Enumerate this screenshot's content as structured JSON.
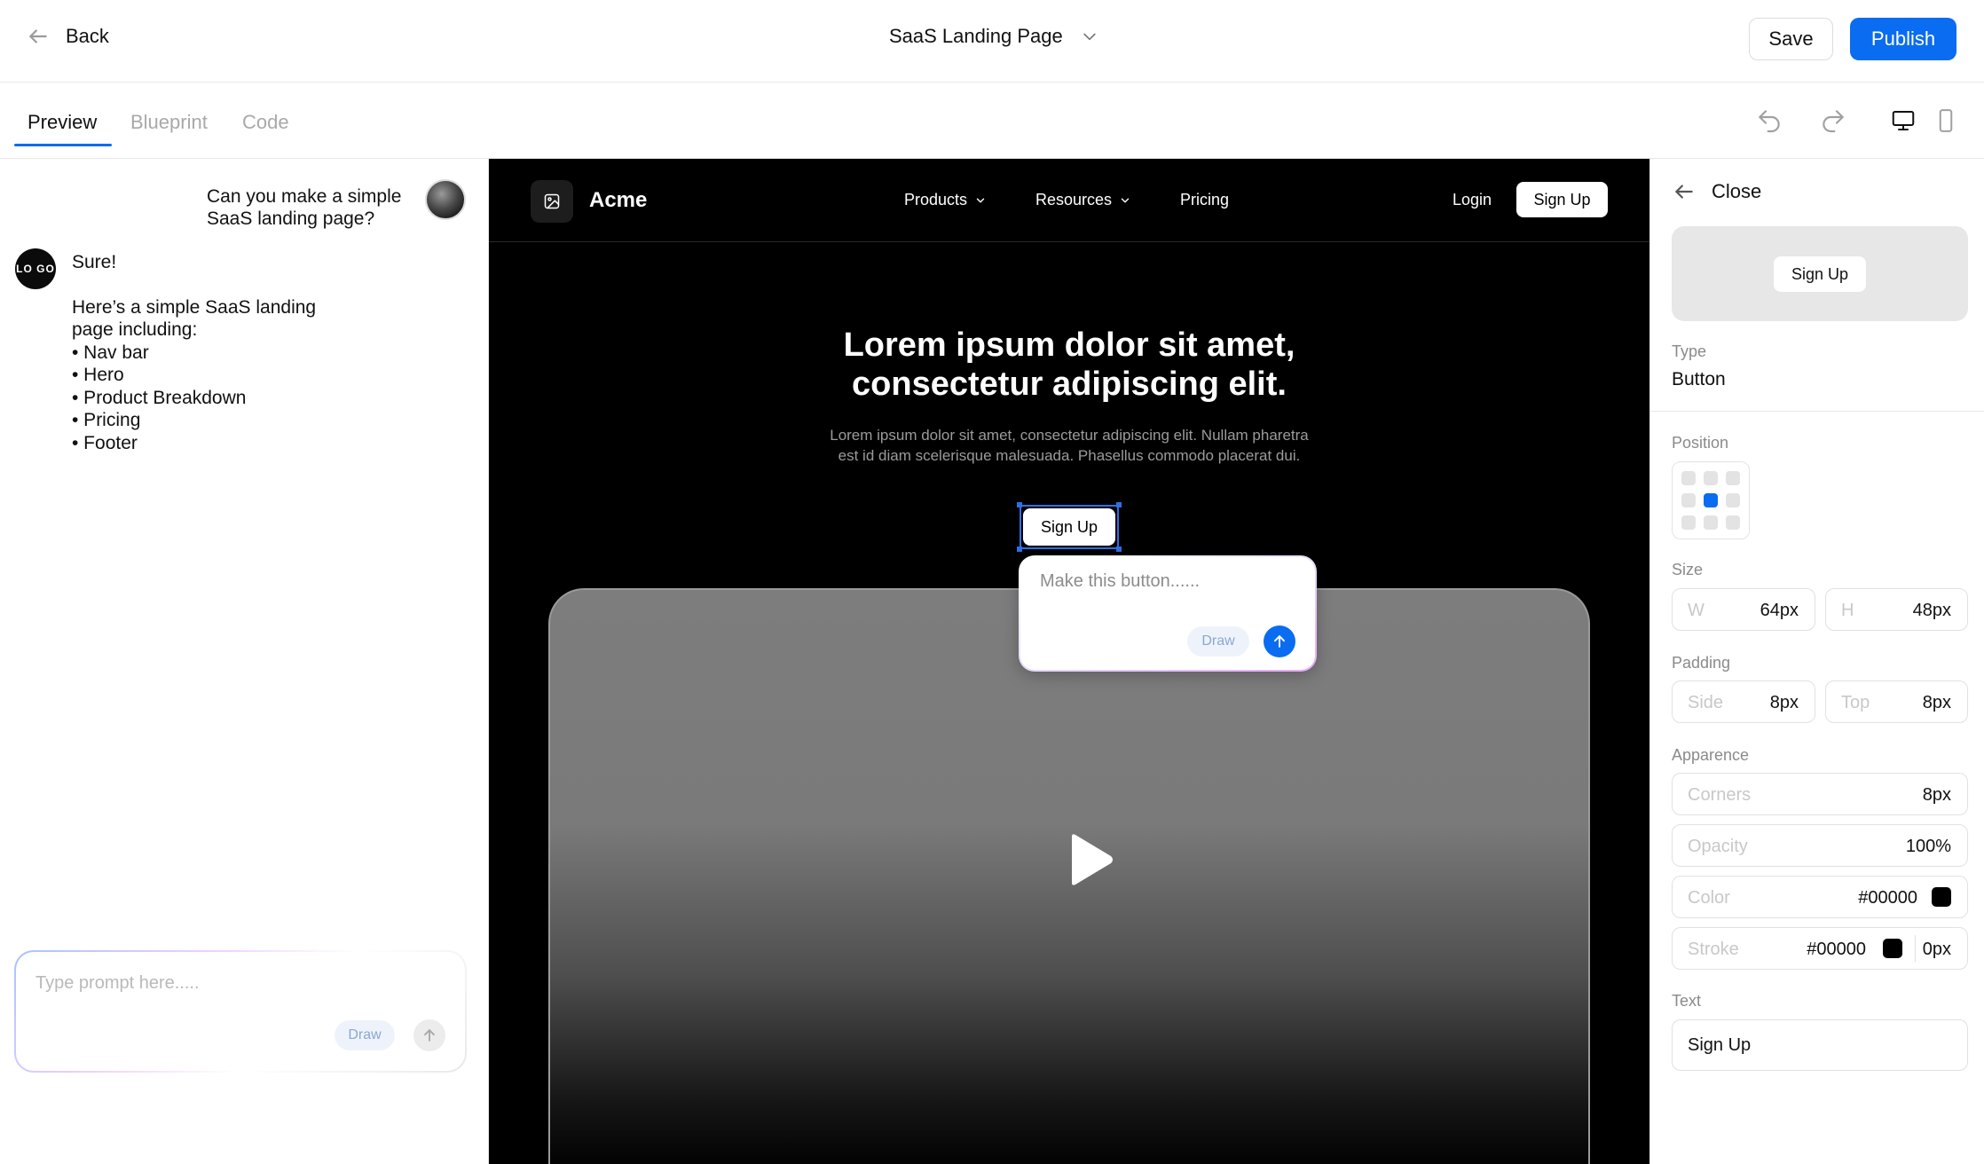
{
  "topbar": {
    "back_label": "Back",
    "project_title": "SaaS Landing Page",
    "save_label": "Save",
    "publish_label": "Publish"
  },
  "tabs": [
    {
      "label": "Preview",
      "active": true
    },
    {
      "label": "Blueprint",
      "active": false
    },
    {
      "label": "Code",
      "active": false
    }
  ],
  "toolbar": {
    "icons": [
      "undo-icon",
      "redo-icon",
      "desktop-icon",
      "mobile-icon"
    ]
  },
  "chat": {
    "user_message": "Can you make a simple SaaS landing page?",
    "ai_avatar_text": "LO GO",
    "ai_greeting": "Sure!",
    "ai_intro": "Here’s a simple SaaS landing page including:",
    "ai_items": [
      "• Nav bar",
      "• Hero",
      "• Product Breakdown",
      "• Pricing",
      "• Footer"
    ],
    "prompt_placeholder": "Type prompt here.....",
    "draw_label": "Draw"
  },
  "site": {
    "brand": "Acme",
    "nav_links": [
      "Products",
      "Resources",
      "Pricing"
    ],
    "login_label": "Login",
    "signup_label": "Sign Up",
    "hero_title_line1": "Lorem ipsum dolor sit amet,",
    "hero_title_line2": "consectetur adipiscing elit.",
    "hero_sub_line1": "Lorem ipsum dolor sit amet, consectetur adipiscing elit. Nullam pharetra",
    "hero_sub_line2": "est id diam scelerisque malesuada. Phasellus commodo placerat dui.",
    "hero_button_label": "Sign Up"
  },
  "edit_popover": {
    "placeholder": "Make this button......",
    "draw_label": "Draw"
  },
  "inspector": {
    "close_label": "Close",
    "preview_button_label": "Sign Up",
    "type_label": "Type",
    "type_value": "Button",
    "position_label": "Position",
    "size_label": "Size",
    "width_label": "W",
    "width_value": "64px",
    "height_label": "H",
    "height_value": "48px",
    "padding_label": "Padding",
    "side_label": "Side",
    "side_value": "8px",
    "top_label": "Top",
    "top_value": "8px",
    "appearance_label": "Apparence",
    "corners_label": "Corners",
    "corners_value": "8px",
    "opacity_label": "Opacity",
    "opacity_value": "100%",
    "color_label": "Color",
    "color_value": "#00000",
    "stroke_label": "Stroke",
    "stroke_color_value": "#00000",
    "stroke_width_value": "0px",
    "text_label": "Text",
    "text_value": "Sign Up"
  },
  "colors": {
    "accent": "#0a6cf0",
    "selection": "#2f6fe4",
    "canvas_bg": "#000000"
  }
}
